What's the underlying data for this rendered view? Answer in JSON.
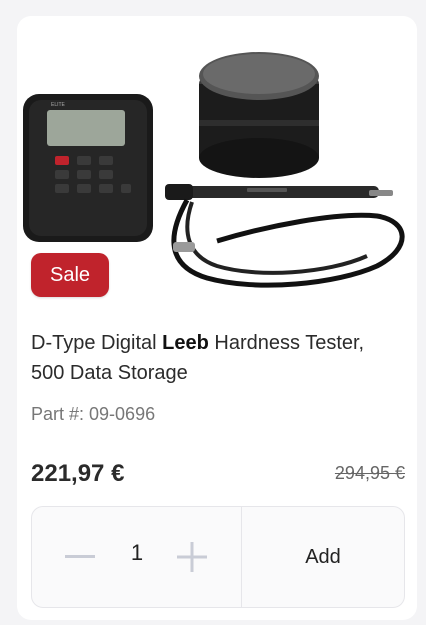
{
  "product": {
    "sale_label": "Sale",
    "title_before": "D-Type Digital ",
    "title_bold": "Leeb",
    "title_after": " Hardness Tester, 500 Data Storage",
    "part_number": "Part #: 09-0696",
    "price": "221,97 €",
    "old_price": "294,95 €",
    "device_brand": "ELITE"
  },
  "cart": {
    "quantity": "1",
    "add_label": "Add"
  },
  "colors": {
    "sale_badge": "#c0232c",
    "text": "#2b2b2b"
  }
}
